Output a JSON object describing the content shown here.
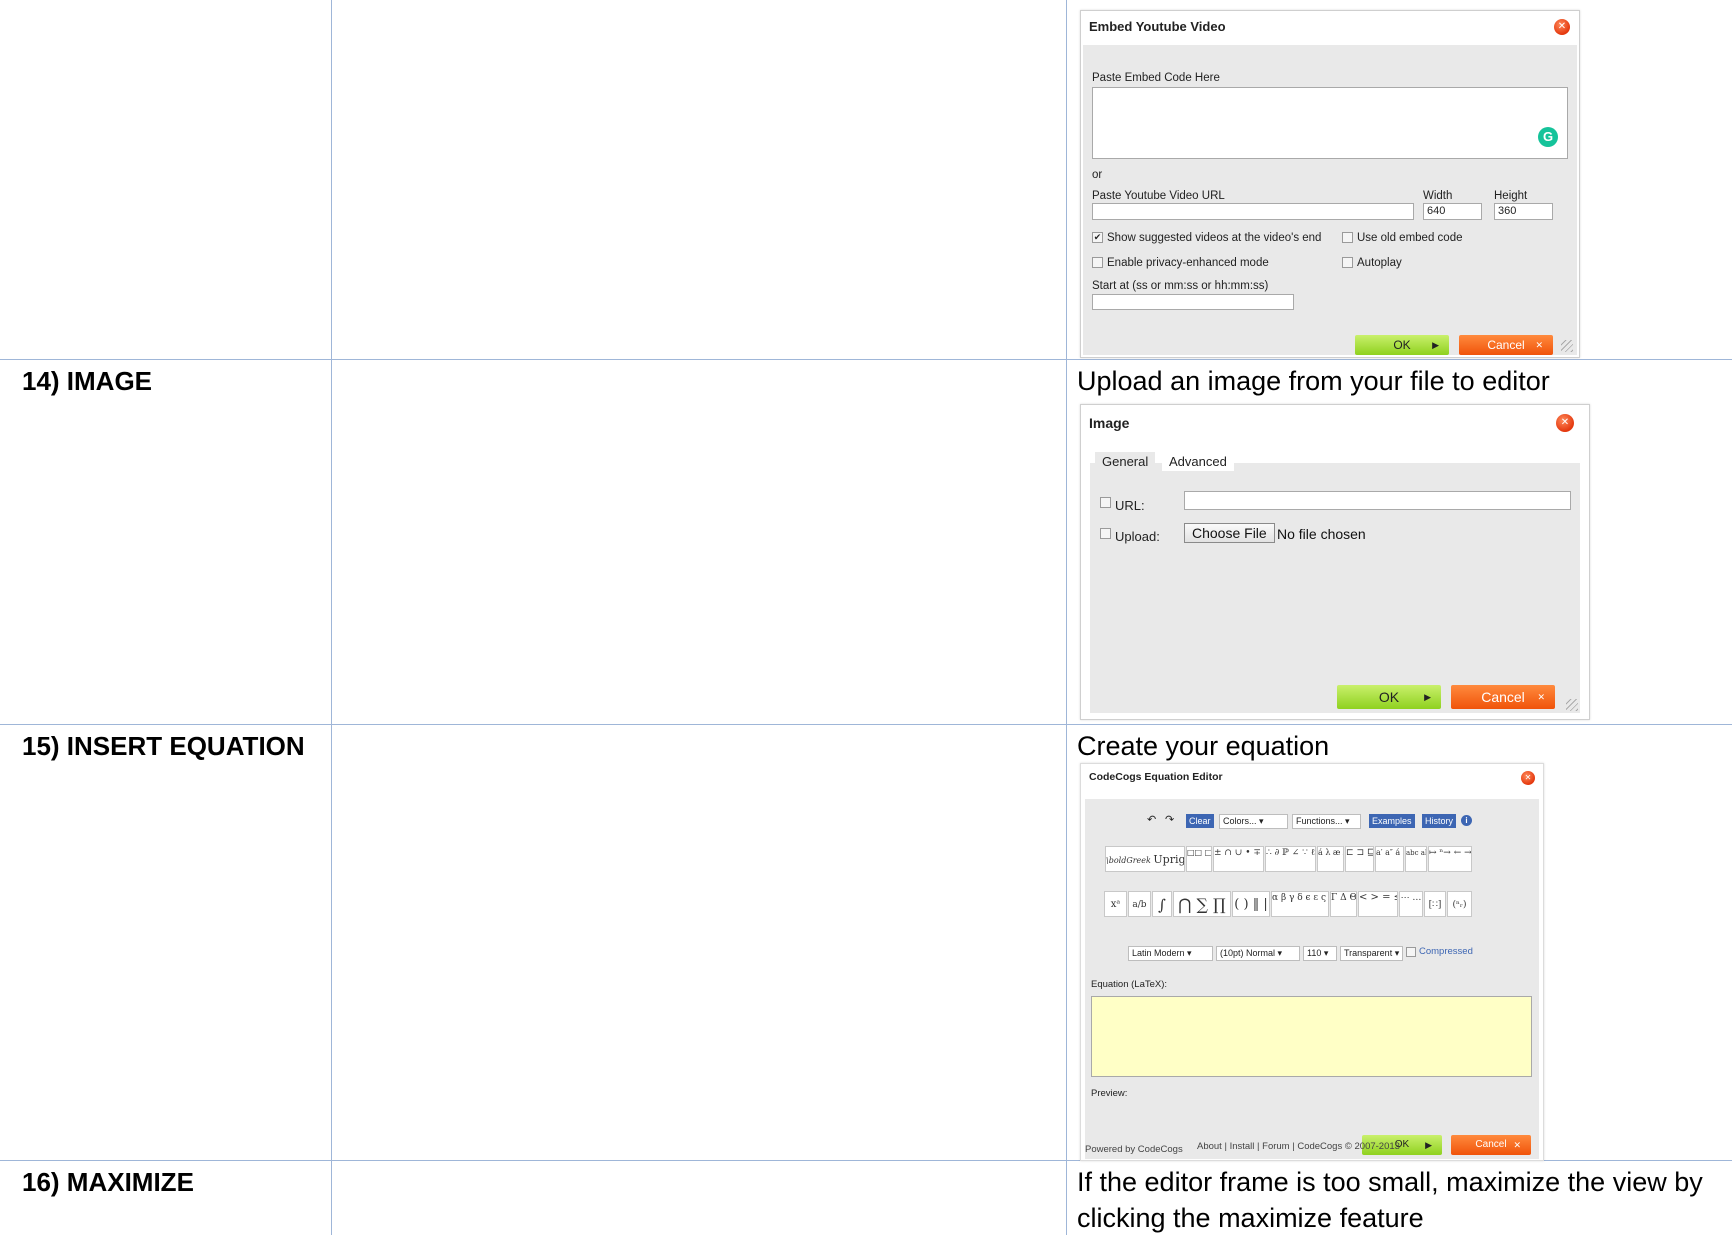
{
  "rows": [
    {
      "label": "14) IMAGE",
      "description": "Upload an image from your file to editor"
    },
    {
      "label": "15) INSERT EQUATION",
      "description": "Create your equation"
    },
    {
      "label": "16) MAXIMIZE",
      "description": "If the editor frame is too small, maximize the view by clicking the maximize feature"
    }
  ],
  "youtube_dialog": {
    "title": "Embed Youtube Video",
    "embed_label": "Paste Embed Code Here",
    "or_label": "or",
    "url_label": "Paste Youtube Video URL",
    "width_label": "Width",
    "width_value": "640",
    "height_label": "Height",
    "height_value": "360",
    "opt_suggested": "Show suggested videos at the video's end",
    "opt_old_embed": "Use old embed code",
    "opt_privacy": "Enable privacy-enhanced mode",
    "opt_autoplay": "Autoplay",
    "start_label": "Start at (ss or mm:ss or hh:mm:ss)",
    "ok": "OK",
    "cancel": "Cancel",
    "grammarly_letter": "G"
  },
  "image_dialog": {
    "title": "Image",
    "tab_general": "General",
    "tab_advanced": "Advanced",
    "url_label": "URL:",
    "upload_label": "Upload:",
    "choose_file": "Choose File",
    "no_file": "No file chosen",
    "ok": "OK",
    "cancel": "Cancel"
  },
  "equation_dialog": {
    "title": "CodeCogs Equation Editor",
    "clear": "Clear",
    "colors": "Colors...",
    "functions": "Functions...",
    "examples": "Examples",
    "history": "History",
    "font_boldgreek": "\\boldGreek",
    "font_upright": "Upright",
    "sym_boxes": "□□ □□",
    "sym_ops": "± ∩ ∪ • ∓ ⋒ ⊎ ⊌",
    "sym_logic": "∴ ∂ ℙ ∠ ∵ ℓ ℕ ∡",
    "sym_accents": "á λ æ Æ",
    "sym_subsets": "⊏ ⊐ ⊑ ⊒",
    "sym_primes": "a′ a″ á ä",
    "sym_over": "abc abc",
    "sym_arrows": "↦ ⁿ→ ← →",
    "sym_power": "xᵃ",
    "sym_frac": "a/b",
    "sym_int": "∫",
    "sym_big": "⋂ ∑ ∏",
    "sym_brackets": "( ) ‖ |",
    "sym_greek": "α β γ δ ϵ ε ς η",
    "sym_greek_upper": "Γ Δ Θ Λ",
    "sym_relations": "< > = ≤ ≥ ≐",
    "sym_dots": "⋯ …",
    "sym_matrix": "[∷]",
    "sym_binom": "(ⁿᵣ)",
    "font_select": "Latin Modern",
    "size_select": "(10pt) Normal",
    "dpi_select": "110",
    "bg_select": "Transparent",
    "compressed": "Compressed",
    "latex_label": "Equation (LaTeX):",
    "preview_label": "Preview:",
    "powered": "Powered by CodeCogs",
    "links": "About | Install | Forum | CodeCogs © 2007-2013",
    "ok": "OK",
    "cancel": "Cancel"
  },
  "colors": {
    "grid": "#9fb6d8",
    "ok_green": "#8fd11f",
    "cancel_orange": "#f0530a",
    "codecogs_blue": "#3d66b3",
    "latex_bg": "#ffffc6"
  }
}
